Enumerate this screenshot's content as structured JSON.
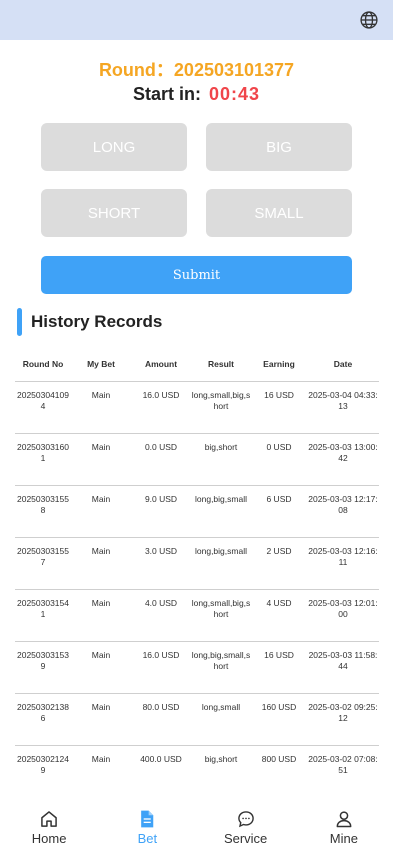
{
  "header": {
    "language_icon": "globe-icon"
  },
  "round": {
    "label": "Round：",
    "number": "202503101377"
  },
  "countdown": {
    "label": "Start in:",
    "time": "00:43"
  },
  "bet_options": {
    "long": "LONG",
    "big": "BIG",
    "short": "SHORT",
    "small": "SMALL"
  },
  "submit_label": "Submit",
  "history": {
    "title": "History Records",
    "columns": [
      "Round No",
      "My Bet",
      "Amount",
      "Result",
      "Earning",
      "Date"
    ],
    "rows": [
      [
        "202503041094",
        "Main",
        "16.0 USD",
        "long,small,big,short",
        "16 USD",
        "2025-03-04 04:33:13"
      ],
      [
        "202503031601",
        "Main",
        "0.0 USD",
        "big,short",
        "0 USD",
        "2025-03-03 13:00:42"
      ],
      [
        "202503031558",
        "Main",
        "9.0 USD",
        "long,big,small",
        "6 USD",
        "2025-03-03 12:17:08"
      ],
      [
        "202503031557",
        "Main",
        "3.0 USD",
        "long,big,small",
        "2 USD",
        "2025-03-03 12:16:11"
      ],
      [
        "202503031541",
        "Main",
        "4.0 USD",
        "long,small,big,short",
        "4 USD",
        "2025-03-03 12:01:00"
      ],
      [
        "202503031539",
        "Main",
        "16.0 USD",
        "long,big,small,short",
        "16 USD",
        "2025-03-03 11:58:44"
      ],
      [
        "202503021386",
        "Main",
        "80.0 USD",
        "long,small",
        "160 USD",
        "2025-03-02 09:25:12"
      ],
      [
        "202503021249",
        "Main",
        "400.0 USD",
        "big,short",
        "800 USD",
        "2025-03-02 07:08:51"
      ]
    ]
  },
  "tabbar": {
    "items": [
      {
        "label": "Home",
        "icon": "home-icon",
        "active": false
      },
      {
        "label": "Bet",
        "icon": "document-icon",
        "active": true
      },
      {
        "label": "Service",
        "icon": "chat-icon",
        "active": false
      },
      {
        "label": "Mine",
        "icon": "user-icon",
        "active": false
      }
    ]
  },
  "colors": {
    "accent": "#3fa2f7",
    "round": "#f5a623",
    "timer": "#f0454a",
    "header_bg": "#d5e0f5"
  }
}
